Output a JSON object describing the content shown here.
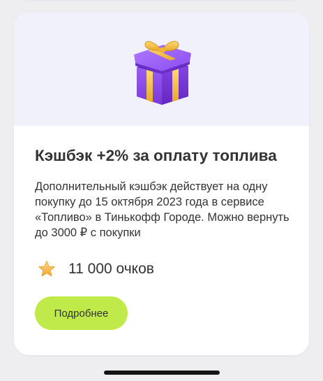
{
  "offer": {
    "title": "Кэшбэк +2% за оплату топлива",
    "description": "Дополнительный кэшбэк действует на одну покупку до 15 октября 2023 года в сервисе «Топливо» в Тинькофф Городе. Можно вернуть до 3000 ₽ с покупки",
    "points": "11 000 очков",
    "button_label": "Подробнее",
    "banner_icon": "gift-box-icon",
    "points_icon": "star-icon"
  },
  "colors": {
    "background": "#eeeef1",
    "card": "#ffffff",
    "banner": "#f1f1fb",
    "button": "#c0ea4a",
    "text": "#333333",
    "gift_box": "#8c4cf0",
    "gift_ribbon": "#f6c343"
  }
}
